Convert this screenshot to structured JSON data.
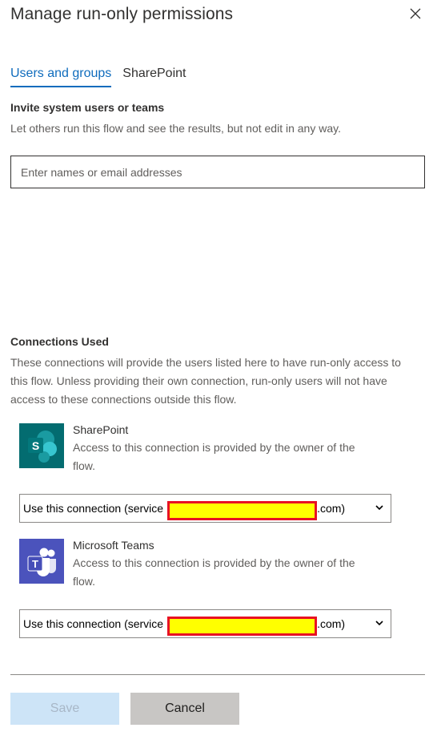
{
  "panel": {
    "title": "Manage run-only permissions",
    "close_icon": "close-icon"
  },
  "tabs": [
    {
      "label": "Users and groups",
      "active": true
    },
    {
      "label": "SharePoint",
      "active": false
    }
  ],
  "invite": {
    "heading": "Invite system users or teams",
    "description": "Let others run this flow and see the results, but not edit in any way.",
    "input_placeholder": "Enter names or email addresses",
    "input_value": ""
  },
  "connections": {
    "heading": "Connections Used",
    "description": "These connections will provide the users listed here to have run-only access to this flow. Unless providing their own connection, run-only users will not have access to these connections outside this flow.",
    "items": [
      {
        "name": "SharePoint",
        "icon": "sharepoint-icon",
        "note": "Access to this connection is provided by the owner of the flow.",
        "select_prefix": "Use this connection (service",
        "select_suffix": ".com)"
      },
      {
        "name": "Microsoft Teams",
        "icon": "teams-icon",
        "note": "Access to this connection is provided by the owner of the flow.",
        "select_prefix": "Use this connection (service",
        "select_suffix": ".com)"
      }
    ]
  },
  "footer": {
    "save_label": "Save",
    "cancel_label": "Cancel"
  },
  "colors": {
    "accent": "#0f6cbd",
    "sharepoint": "#036c70",
    "teams": "#4b53bc",
    "redaction_fill": "#ffff00",
    "redaction_border": "#e81123"
  }
}
